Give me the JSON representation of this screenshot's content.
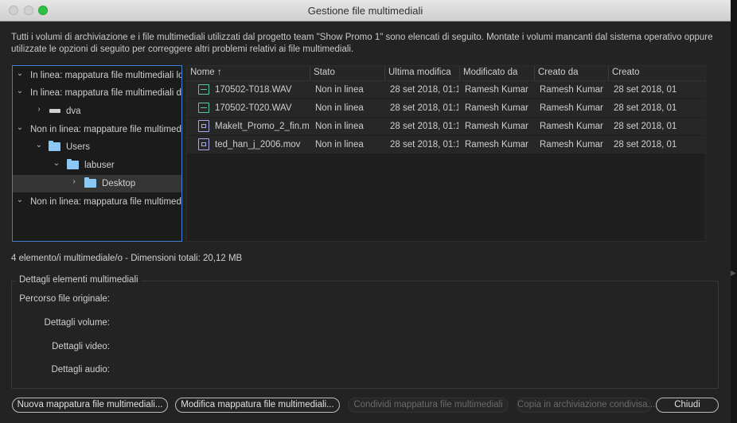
{
  "window": {
    "title": "Gestione file multimediali"
  },
  "description": "Tutti i volumi di archiviazione e i file multimediali utilizzati dal progetto team \"Show Promo 1\" sono elencati di seguito. Montate i volumi mancanti dal sistema operativo oppure utilizzate le opzioni di seguito per correggere altri problemi relativi ai file multimediali.",
  "tree": [
    {
      "label": "In linea: mappatura file multimediali lo",
      "expanded": true,
      "icon": "none"
    },
    {
      "label": "In linea: mappatura file multimediali di",
      "expanded": true,
      "icon": "none"
    },
    {
      "label": "dva",
      "expanded": false,
      "icon": "drive-icon"
    },
    {
      "label": "Non in linea: mappature file multimedi",
      "expanded": true,
      "icon": "none"
    },
    {
      "label": "Users",
      "expanded": true,
      "icon": "folder-icon"
    },
    {
      "label": "labuser",
      "expanded": true,
      "icon": "folder-icon"
    },
    {
      "label": "Desktop",
      "expanded": false,
      "icon": "folder-icon",
      "selected": true
    },
    {
      "label": "Non in linea: mappatura file multimedi",
      "expanded": true,
      "icon": "none"
    }
  ],
  "table": {
    "columns": [
      "Nome",
      "Stato",
      "Ultima modifica",
      "Modificato da",
      "Creato da",
      "Creato"
    ],
    "sort_indicator": "↑",
    "rows": [
      {
        "type": "audio",
        "name": "170502-T018.WAV",
        "stato": "Non in linea",
        "ultima_modifica": "28 set 2018, 01:1",
        "modificato_da": "Ramesh Kumar",
        "creato_da": "Ramesh Kumar",
        "creato": "28 set 2018, 01"
      },
      {
        "type": "audio",
        "name": "170502-T020.WAV",
        "stato": "Non in linea",
        "ultima_modifica": "28 set 2018, 01:1",
        "modificato_da": "Ramesh Kumar",
        "creato_da": "Ramesh Kumar",
        "creato": "28 set 2018, 01"
      },
      {
        "type": "video",
        "name": "MakeIt_Promo_2_fin.m",
        "stato": "Non in linea",
        "ultima_modifica": "28 set 2018, 01:1",
        "modificato_da": "Ramesh Kumar",
        "creato_da": "Ramesh Kumar",
        "creato": "28 set 2018, 01"
      },
      {
        "type": "video",
        "name": "ted_han_j_2006.mov",
        "stato": "Non in linea",
        "ultima_modifica": "28 set 2018, 01:1",
        "modificato_da": "Ramesh Kumar",
        "creato_da": "Ramesh Kumar",
        "creato": "28 set 2018, 01"
      }
    ]
  },
  "summary": "4 elemento/i multimediale/o - Dimensioni totali: 20,12 MB",
  "details": {
    "legend": "Dettagli elementi multimediali",
    "labels": [
      "Percorso file originale:",
      "Dettagli volume:",
      "Dettagli video:",
      "Dettagli audio:"
    ]
  },
  "buttons": {
    "new_mapping": "Nuova mappatura file multimediali...",
    "edit_mapping": "Modifica mappatura file multimediali...",
    "share_mapping": "Condividi mappatura file multimediali",
    "copy_shared": "Copia in archiviazione condivisa...",
    "close": "Chiudi"
  }
}
